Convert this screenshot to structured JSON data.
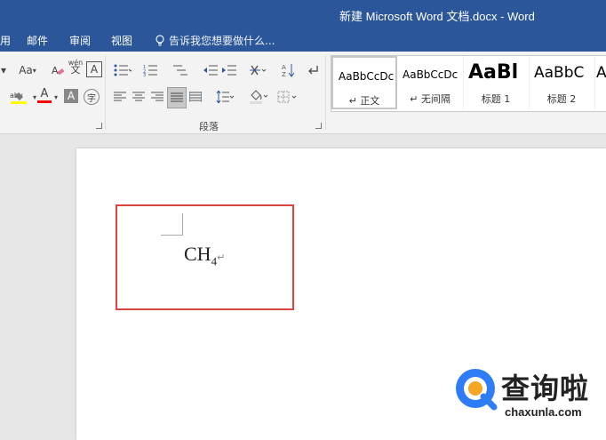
{
  "window": {
    "title": "新建 Microsoft Word 文档.docx - Word"
  },
  "tabs": [
    {
      "label": "用"
    },
    {
      "label": "邮件"
    },
    {
      "label": "审阅"
    },
    {
      "label": "视图"
    }
  ],
  "tell_me": {
    "placeholder": "告诉我您想要做什么..."
  },
  "ribbon": {
    "group_paragraph": "段落",
    "font_size_btn": "Aa",
    "wen_char": "wén",
    "highlight_label": "aby",
    "font_color_label": "A"
  },
  "styles": [
    {
      "preview": "AaBbCcDc",
      "name": "↵ 正文",
      "selected": true
    },
    {
      "preview": "AaBbCcDc",
      "name": "↵ 无间隔"
    },
    {
      "preview": "AaBl",
      "name": "标题 1"
    },
    {
      "preview": "AaBbC",
      "name": "标题 2"
    },
    {
      "preview": "A",
      "name": ""
    }
  ],
  "document": {
    "formula_main": "CH",
    "formula_sub": "4",
    "paragraph_mark": "↵"
  },
  "watermark": {
    "name_cn": "查询啦",
    "url": "chaxunla.com"
  },
  "colors": {
    "titlebar": "#2b579a",
    "highlight": "#ffff00",
    "font_color": "#ff0000",
    "selection_box": "#d9463f"
  }
}
